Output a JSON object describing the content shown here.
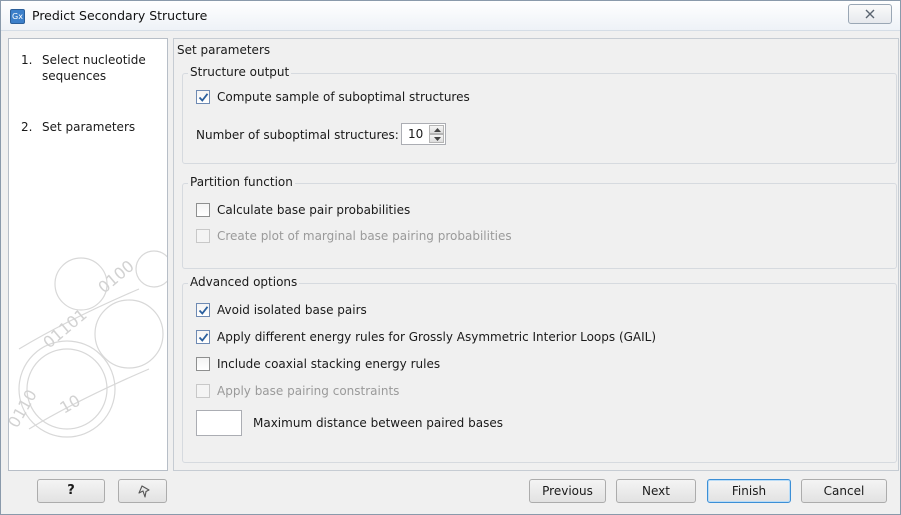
{
  "window": {
    "app_icon_text": "Gx",
    "title": "Predict Secondary Structure"
  },
  "steps": [
    {
      "num": "1.",
      "label": "Select nucleotide sequences"
    },
    {
      "num": "2.",
      "label": "Set parameters"
    }
  ],
  "main": {
    "heading": "Set parameters",
    "structure_output": {
      "title": "Structure output",
      "compute_label": "Compute sample of suboptimal structures",
      "compute_checked": true,
      "num_label": "Number of suboptimal structures:",
      "num_value": "10"
    },
    "partition_function": {
      "title": "Partition function",
      "calc_label": "Calculate base pair probabilities",
      "calc_checked": false,
      "plot_label": "Create plot of marginal base pairing probabilities",
      "plot_enabled": false
    },
    "advanced": {
      "title": "Advanced options",
      "avoid_label": "Avoid isolated base pairs",
      "avoid_checked": true,
      "gail_label": "Apply different energy rules for Grossly Asymmetric Interior Loops (GAIL)",
      "gail_checked": true,
      "coaxial_label": "Include coaxial stacking energy rules",
      "coaxial_checked": false,
      "constraints_label": "Apply base pairing constraints",
      "constraints_enabled": false,
      "max_distance_label": "Maximum distance between paired bases",
      "max_distance_value": ""
    }
  },
  "buttons": {
    "help": "?",
    "previous": "Previous",
    "next": "Next",
    "finish": "Finish",
    "cancel": "Cancel"
  },
  "icons": {
    "close": "close-icon",
    "reset": "reset-arrow-icon",
    "check": "checkmark-icon"
  },
  "colors": {
    "title_blue": "#3c7fc9",
    "check_blue": "#2a5f9e",
    "default_button_border": "#3c8fd6"
  }
}
